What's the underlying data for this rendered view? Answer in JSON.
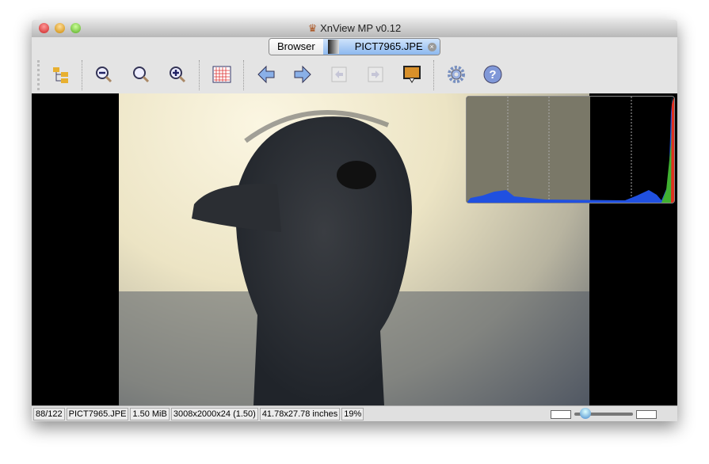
{
  "window": {
    "title": "XnView MP v0.12"
  },
  "tabs": [
    {
      "label": "Browser"
    },
    {
      "label": "PICT7965.JPE"
    }
  ],
  "toolbar": {
    "items": [
      "folder-tree-icon",
      "zoom-out-icon",
      "zoom-fit-icon",
      "zoom-in-icon",
      "grid-icon",
      "previous-icon",
      "next-icon",
      "previous-page-icon",
      "next-page-icon",
      "slideshow-icon",
      "settings-icon",
      "help-icon"
    ]
  },
  "status": {
    "index": "88/122",
    "filename": "PICT7965.JPE",
    "filesize": "1.50 MiB",
    "dimensions": "3008x2000x24 (1.50)",
    "print_size": "41.78x27.78 inches",
    "zoom": "19%"
  },
  "zoom_slider": {
    "value_percent": 19
  },
  "colors": {
    "accent": "#8cb8ef"
  }
}
